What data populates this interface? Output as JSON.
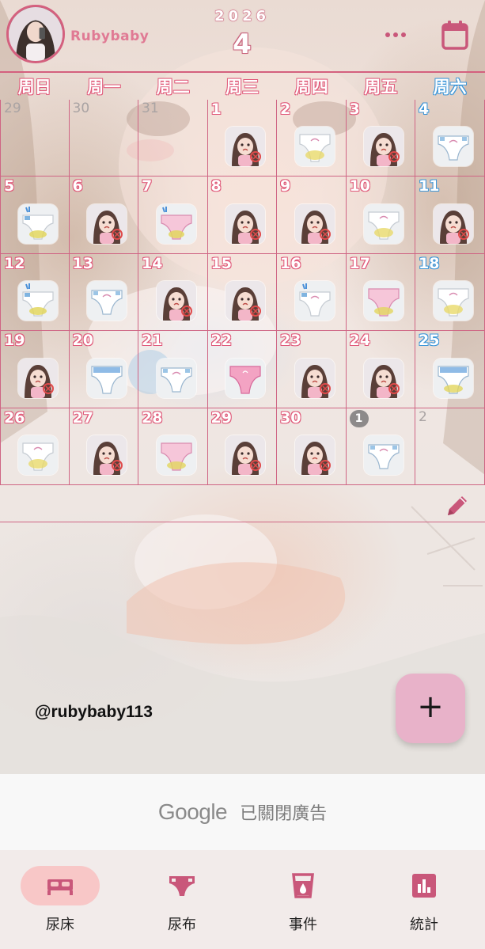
{
  "header": {
    "username": "Rubybaby",
    "year": "2026",
    "month": "4",
    "more_icon": "more-dots-icon",
    "calendar_icon": "calendar-icon"
  },
  "weekdays": [
    {
      "label": "周日",
      "color": "red"
    },
    {
      "label": "周一",
      "color": "red"
    },
    {
      "label": "周二",
      "color": "red"
    },
    {
      "label": "周三",
      "color": "red"
    },
    {
      "label": "周四",
      "color": "red"
    },
    {
      "label": "周五",
      "color": "red"
    },
    {
      "label": "周六",
      "color": "blue"
    }
  ],
  "weeks": [
    [
      {
        "day": "29",
        "style": "gray",
        "icon": null
      },
      {
        "day": "30",
        "style": "gray",
        "icon": null
      },
      {
        "day": "31",
        "style": "gray",
        "icon": null
      },
      {
        "day": "1",
        "style": "red",
        "icon": "girl-crying"
      },
      {
        "day": "2",
        "style": "red",
        "icon": "diaper-wet"
      },
      {
        "day": "3",
        "style": "red",
        "icon": "girl-crying"
      },
      {
        "day": "4",
        "style": "blue",
        "icon": "diaper-dry"
      }
    ],
    [
      {
        "day": "5",
        "style": "red",
        "icon": "diaper-leak"
      },
      {
        "day": "6",
        "style": "red",
        "icon": "girl-crying"
      },
      {
        "day": "7",
        "style": "red",
        "icon": "diaper-pink-leak"
      },
      {
        "day": "8",
        "style": "red",
        "icon": "girl-crying"
      },
      {
        "day": "9",
        "style": "red",
        "icon": "girl-crying"
      },
      {
        "day": "10",
        "style": "red",
        "icon": "diaper-wet"
      },
      {
        "day": "11",
        "style": "blue",
        "icon": "girl-crying"
      }
    ],
    [
      {
        "day": "12",
        "style": "red",
        "icon": "diaper-leak"
      },
      {
        "day": "13",
        "style": "red",
        "icon": "diaper-dry"
      },
      {
        "day": "14",
        "style": "red",
        "icon": "girl-crying"
      },
      {
        "day": "15",
        "style": "red",
        "icon": "girl-crying"
      },
      {
        "day": "16",
        "style": "red",
        "icon": "diaper-leak-dry"
      },
      {
        "day": "17",
        "style": "red",
        "icon": "diaper-pink-wet"
      },
      {
        "day": "18",
        "style": "blue",
        "icon": "diaper-wet"
      }
    ],
    [
      {
        "day": "19",
        "style": "red",
        "icon": "girl-crying"
      },
      {
        "day": "20",
        "style": "red",
        "icon": "diaper-blue"
      },
      {
        "day": "21",
        "style": "red",
        "icon": "diaper-dry"
      },
      {
        "day": "22",
        "style": "red",
        "icon": "diaper-pink"
      },
      {
        "day": "23",
        "style": "red",
        "icon": "girl-crying"
      },
      {
        "day": "24",
        "style": "red",
        "icon": "girl-crying"
      },
      {
        "day": "25",
        "style": "blue",
        "icon": "diaper-blue-wet"
      }
    ],
    [
      {
        "day": "26",
        "style": "red",
        "icon": "diaper-wet"
      },
      {
        "day": "27",
        "style": "red",
        "icon": "girl-crying"
      },
      {
        "day": "28",
        "style": "red",
        "icon": "diaper-pink-wet"
      },
      {
        "day": "29",
        "style": "red",
        "icon": "girl-crying"
      },
      {
        "day": "30",
        "style": "red",
        "icon": "girl-crying"
      },
      {
        "day": "1",
        "style": "pill",
        "icon": "diaper-dry"
      },
      {
        "day": "2",
        "style": "gray",
        "icon": null
      }
    ]
  ],
  "edit_icon": "pencil-icon",
  "watermark": "@rubybaby113",
  "fab": {
    "label": "+",
    "icon": "plus-icon"
  },
  "ad": {
    "brand": "Google",
    "text": "已關閉廣告"
  },
  "nav": [
    {
      "label": "尿床",
      "icon": "bed-icon",
      "active": true
    },
    {
      "label": "尿布",
      "icon": "diaper-icon",
      "active": false
    },
    {
      "label": "事件",
      "icon": "cup-drop-icon",
      "active": false
    },
    {
      "label": "統計",
      "icon": "bar-chart-icon",
      "active": false
    }
  ],
  "colors": {
    "accent": "#d4607e",
    "sunday_red": "#e05a7a",
    "saturday_blue": "#3d96d8",
    "fab": "#e8b2c9",
    "nav_active_pill": "#f8c7c7",
    "nav_icon": "#c9577a"
  }
}
